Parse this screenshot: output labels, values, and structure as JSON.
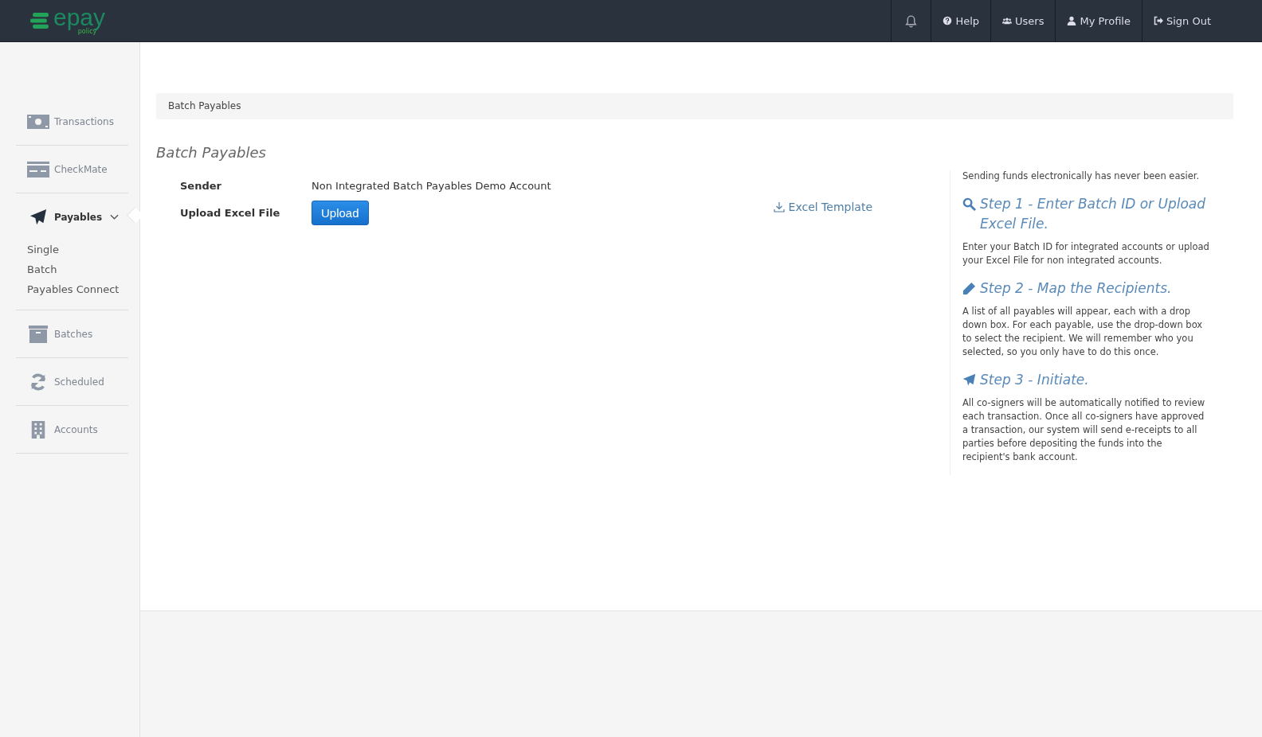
{
  "header": {
    "logo": {
      "name": "epay",
      "sub": "policy"
    },
    "nav": [
      {
        "kind": "bell"
      },
      {
        "kind": "help",
        "label": "Help"
      },
      {
        "kind": "users",
        "label": "Users"
      },
      {
        "kind": "profile",
        "label": "My Profile"
      },
      {
        "kind": "signout",
        "label": "Sign Out"
      }
    ]
  },
  "sidebar": {
    "items": [
      {
        "kind": "money",
        "label": "Transactions",
        "selected": false
      },
      {
        "kind": "card",
        "label": "CheckMate",
        "selected": false
      },
      {
        "kind": "plane",
        "label": "Payables",
        "selected": true,
        "expanded": true,
        "children": [
          {
            "label": "Single"
          },
          {
            "label": "Batch"
          },
          {
            "label": "Payables Connect"
          }
        ]
      },
      {
        "kind": "archive",
        "label": "Batches",
        "selected": false
      },
      {
        "kind": "refresh",
        "label": "Scheduled",
        "selected": false
      },
      {
        "kind": "building",
        "label": "Accounts",
        "selected": false
      }
    ]
  },
  "breadcrumb": "Batch Payables",
  "page_title": "Batch Payables",
  "form": {
    "fields": [
      {
        "label": "Sender",
        "value": "Non Integrated Batch Payables Demo Account"
      },
      {
        "label": "Upload Excel File",
        "button": "Upload"
      }
    ],
    "template_link": "Excel Template"
  },
  "help": {
    "intro": "Sending funds electronically has never been easier.",
    "steps": [
      {
        "kind": "search",
        "title": "Step 1 - Enter Batch ID or Upload Excel File.",
        "text": "Enter your Batch ID for integrated accounts or upload your Excel File for non integrated accounts."
      },
      {
        "kind": "pencil",
        "title": "Step 2 - Map the Recipients.",
        "text": "A list of all payables will appear, each with a drop down box. For each payable, use the drop-down box to select the recipient. We will remember who you selected, so you only have to do this once."
      },
      {
        "kind": "plane",
        "title": "Step 3 - Initiate.",
        "text": "All co-signers will be automatically notified to review each transaction. Once all co-signers have approved a transaction, our system will send e-receipts to all parties before depositing the funds into the recipient's bank account."
      }
    ]
  }
}
